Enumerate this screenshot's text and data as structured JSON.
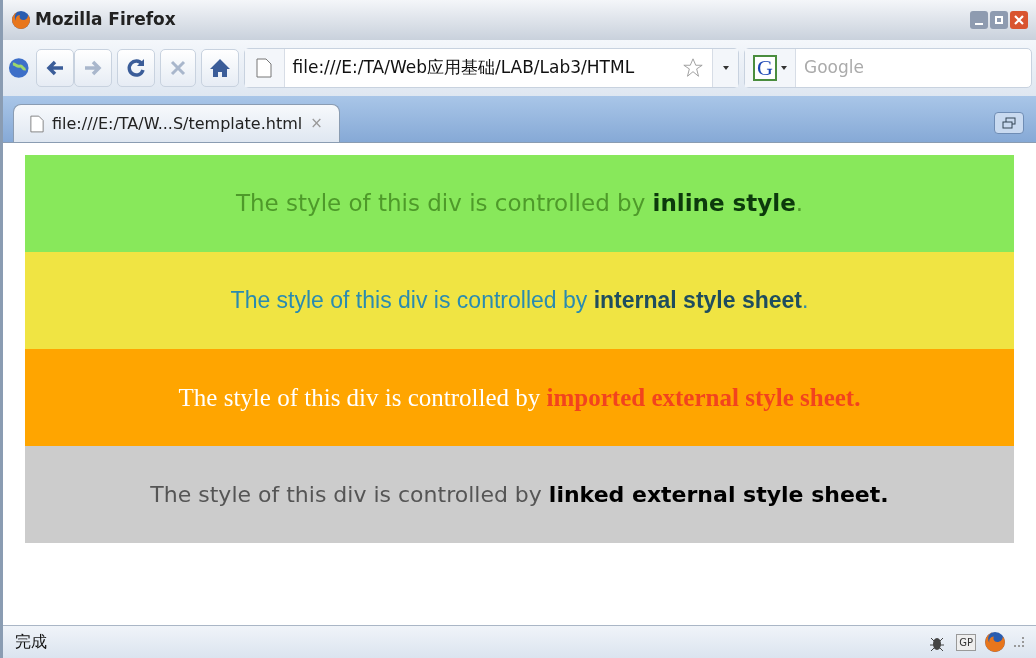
{
  "window": {
    "title": "Mozilla Firefox"
  },
  "toolbar": {
    "address": "file:///E:/TA/Web应用基础/LAB/Lab3/HTML",
    "search_engine": "G",
    "search": {
      "placeholder": "Google"
    }
  },
  "tabs": [
    {
      "label": "file:///E:/TA/W...S/template.html",
      "selected": true,
      "close": "×"
    }
  ],
  "divs": [
    {
      "kind": "inline",
      "lead": "The style of this div is controlled by ",
      "emphasis": "inline style",
      "tail": "."
    },
    {
      "kind": "internal",
      "lead": "The style of this div is controlled by ",
      "emphasis": "internal style sheet",
      "tail": "."
    },
    {
      "kind": "imported",
      "lead": "The style of this div is controlled by ",
      "emphasis": "imported external style sheet."
    },
    {
      "kind": "linked",
      "lead": "The style of this div is controlled by ",
      "emphasis": "linked external style sheet."
    }
  ],
  "status_bar": {
    "text": "完成",
    "badge": "GP"
  }
}
